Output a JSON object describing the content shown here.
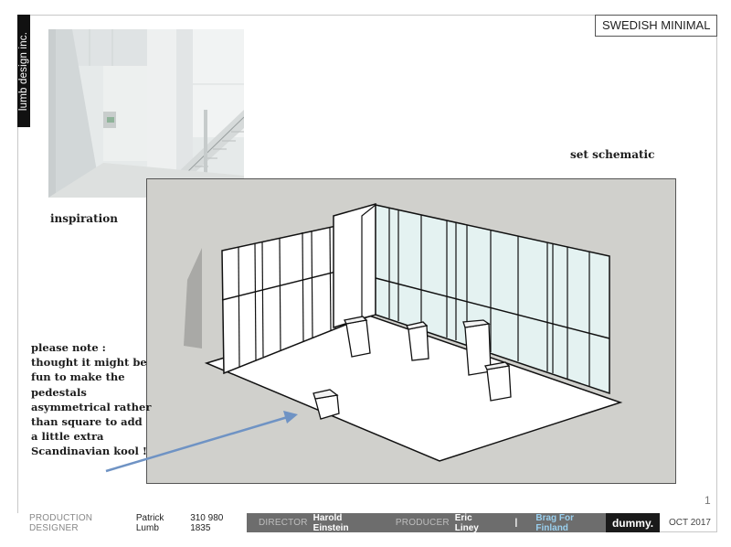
{
  "brand": {
    "name": "lumb design inc."
  },
  "header": {
    "title": "SWEDISH MINIMAL"
  },
  "captions": {
    "inspiration": "inspiration",
    "schematic": "set schematic"
  },
  "note": {
    "lines": [
      "please note :",
      "thought it might be",
      "fun to make the",
      "pedestals",
      "asymmetrical rather",
      "than square to add",
      "a little extra",
      "Scandinavian kool !"
    ]
  },
  "page": {
    "number": "1"
  },
  "footer": {
    "production_designer_label": "PRODUCTION DESIGNER",
    "production_designer_name": "Patrick Lumb",
    "phone": "310 980 1835",
    "director_label": "DIRECTOR",
    "director_name": "Harold Einstein",
    "producer_label": "PRODUCER",
    "producer_name": "Eric Liney",
    "separator": "|",
    "show_title": "Brag For Finland",
    "client_logo": "dummy.",
    "date": "OCT 2017"
  },
  "colors": {
    "arrow": "#6f93c4",
    "footer_band": "#6d6d6d",
    "show_title": "#9ad0ef"
  }
}
